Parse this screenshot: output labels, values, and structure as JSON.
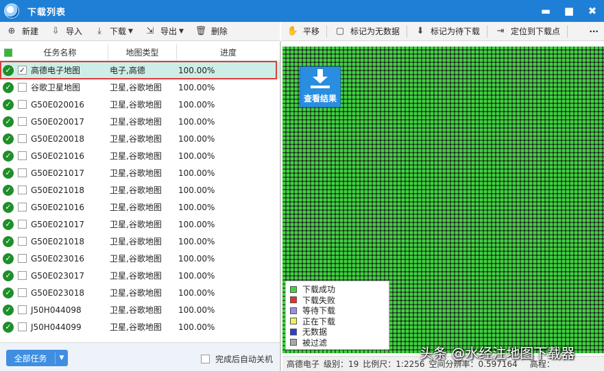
{
  "window": {
    "title": "下载列表",
    "minimize": "▬",
    "maximize": "■",
    "close": "✖"
  },
  "toolbar_left": [
    {
      "label": "新建",
      "icon": "plus-circle-icon",
      "glyph": "⊕",
      "dropdown": false
    },
    {
      "label": "导入",
      "icon": "import-icon",
      "glyph": "⇩",
      "dropdown": false
    },
    {
      "label": "下载",
      "icon": "download-icon",
      "glyph": "⤓",
      "dropdown": true
    },
    {
      "label": "导出",
      "icon": "export-icon",
      "glyph": "⇲",
      "dropdown": true
    },
    {
      "label": "删除",
      "icon": "trash-icon",
      "glyph": "🗑",
      "dropdown": false
    }
  ],
  "toolbar_right": [
    {
      "label": "平移",
      "icon": "pan-hand-icon",
      "glyph": "✋"
    },
    {
      "label": "标记为无数据",
      "icon": "mark-nodata-icon",
      "glyph": "▢"
    },
    {
      "label": "标记为待下载",
      "icon": "mark-pending-icon",
      "glyph": "⬇"
    },
    {
      "label": "定位到下载点",
      "icon": "locate-icon",
      "glyph": "⇥"
    },
    {
      "label": "···",
      "icon": "more-icon",
      "glyph": ""
    }
  ],
  "table": {
    "columns": [
      "任务名称",
      "地图类型",
      "进度"
    ],
    "rows": [
      {
        "name": "高德电子地图",
        "type": "电子,高德",
        "progress": "100.00%",
        "checked": true,
        "selected": true
      },
      {
        "name": "谷歌卫星地图",
        "type": "卫星,谷歌地图",
        "progress": "100.00%",
        "checked": false,
        "selected": false
      },
      {
        "name": "G50E020016",
        "type": "卫星,谷歌地图",
        "progress": "100.00%",
        "checked": false,
        "selected": false
      },
      {
        "name": "G50E020017",
        "type": "卫星,谷歌地图",
        "progress": "100.00%",
        "checked": false,
        "selected": false
      },
      {
        "name": "G50E020018",
        "type": "卫星,谷歌地图",
        "progress": "100.00%",
        "checked": false,
        "selected": false
      },
      {
        "name": "G50E021016",
        "type": "卫星,谷歌地图",
        "progress": "100.00%",
        "checked": false,
        "selected": false
      },
      {
        "name": "G50E021017",
        "type": "卫星,谷歌地图",
        "progress": "100.00%",
        "checked": false,
        "selected": false
      },
      {
        "name": "G50E021018",
        "type": "卫星,谷歌地图",
        "progress": "100.00%",
        "checked": false,
        "selected": false
      },
      {
        "name": "G50E021016",
        "type": "卫星,谷歌地图",
        "progress": "100.00%",
        "checked": false,
        "selected": false
      },
      {
        "name": "G50E021017",
        "type": "卫星,谷歌地图",
        "progress": "100.00%",
        "checked": false,
        "selected": false
      },
      {
        "name": "G50E021018",
        "type": "卫星,谷歌地图",
        "progress": "100.00%",
        "checked": false,
        "selected": false
      },
      {
        "name": "G50E023016",
        "type": "卫星,谷歌地图",
        "progress": "100.00%",
        "checked": false,
        "selected": false
      },
      {
        "name": "G50E023017",
        "type": "卫星,谷歌地图",
        "progress": "100.00%",
        "checked": false,
        "selected": false
      },
      {
        "name": "G50E023018",
        "type": "卫星,谷歌地图",
        "progress": "100.00%",
        "checked": false,
        "selected": false
      },
      {
        "name": "J50H044098",
        "type": "卫星,谷歌地图",
        "progress": "100.00%",
        "checked": false,
        "selected": false
      },
      {
        "name": "J50H044099",
        "type": "卫星,谷歌地图",
        "progress": "100.00%",
        "checked": false,
        "selected": false
      }
    ]
  },
  "bottom": {
    "all_tasks": "全部任务",
    "auto_shutdown": "完成后自动关机"
  },
  "map": {
    "view_result": "查看结果",
    "legend": [
      {
        "label": "下载成功",
        "color": "#3ed43e"
      },
      {
        "label": "下载失败",
        "color": "#e53030"
      },
      {
        "label": "等待下载",
        "color": "#9a8de8"
      },
      {
        "label": "正在下载",
        "color": "#f2ee5a"
      },
      {
        "label": "无数据",
        "color": "#2f3fd0"
      },
      {
        "label": "被过滤",
        "color": "#a8a8a8"
      }
    ],
    "status": {
      "layer": "高德电子",
      "level": "级别：19",
      "scale": "比例尺：1:2256",
      "resolution": "空间分辨率：0.597164",
      "elevation": "高程："
    }
  },
  "watermark": "头条 @水经注地图下载器"
}
